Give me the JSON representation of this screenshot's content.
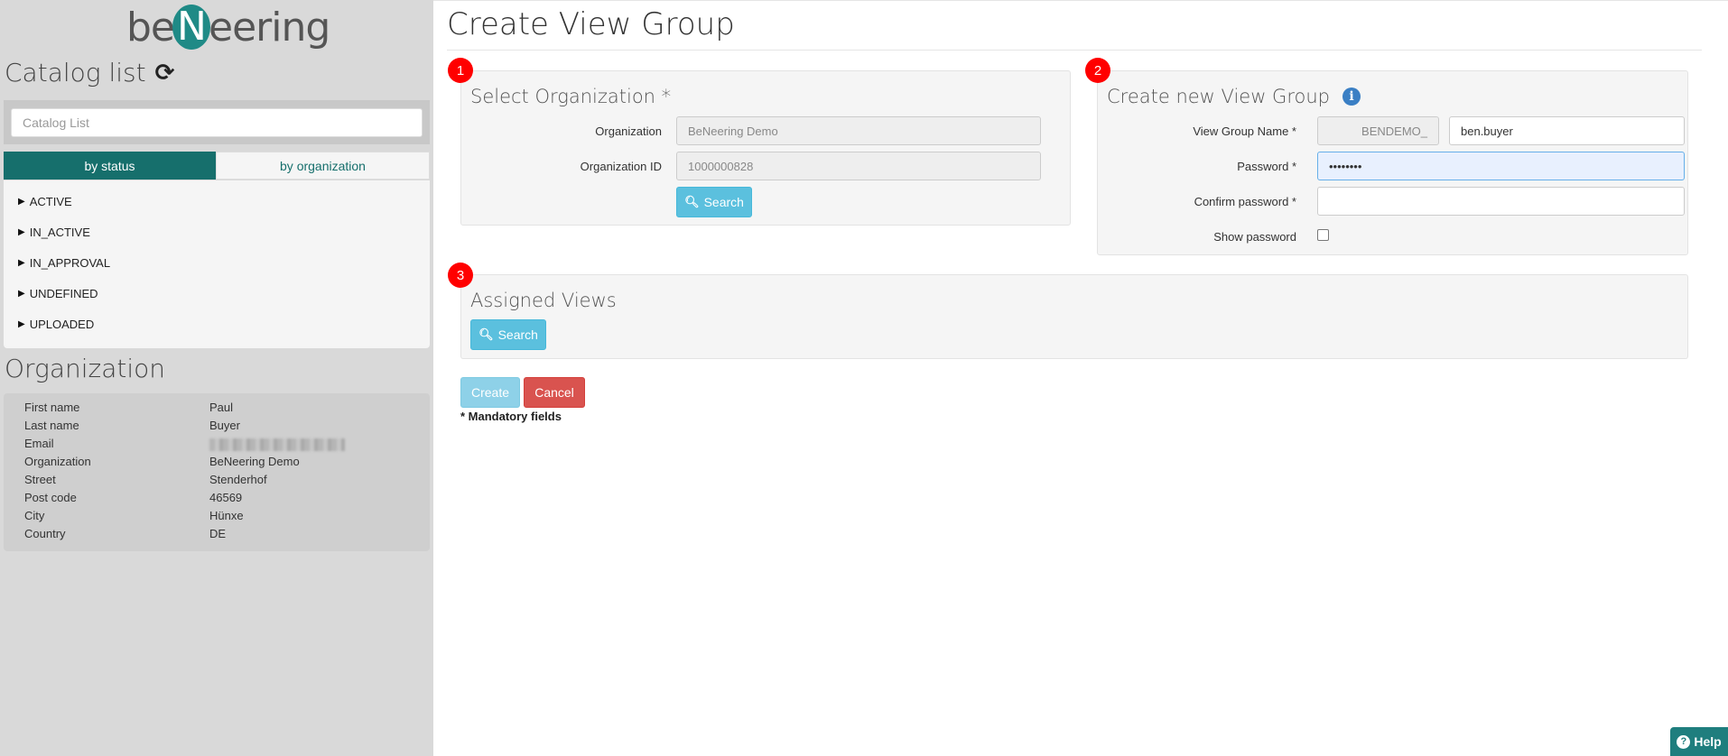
{
  "sidebar": {
    "logo": {
      "pre": "be",
      "mid": "N",
      "post": "eering"
    },
    "catalog_title": "Catalog list",
    "catalog_search_placeholder": "Catalog List",
    "tabs": {
      "by_status": "by status",
      "by_organization": "by organization"
    },
    "status_items": [
      "ACTIVE",
      "IN_ACTIVE",
      "IN_APPROVAL",
      "UNDEFINED",
      "UPLOADED"
    ],
    "organization_title": "Organization",
    "organization": {
      "first_name_label": "First name",
      "first_name": "Paul",
      "last_name_label": "Last name",
      "last_name": "Buyer",
      "email_label": "Email",
      "organization_label": "Organization",
      "organization": "BeNeering Demo",
      "street_label": "Street",
      "street": "Stenderhof",
      "post_code_label": "Post code",
      "post_code": "46569",
      "city_label": "City",
      "city": "Hünxe",
      "country_label": "Country",
      "country": "DE"
    }
  },
  "main": {
    "title": "Create View Group",
    "select_org": {
      "badge": "1",
      "heading": "Select Organization *",
      "organization_label": "Organization",
      "organization_value": "BeNeering Demo",
      "org_id_label": "Organization ID",
      "org_id_value": "1000000828",
      "search_label": "Search"
    },
    "new_group": {
      "badge": "2",
      "heading": "Create new View Group",
      "name_label": "View Group Name *",
      "name_prefix": "BENDEMO_",
      "name_value": "ben.buyer",
      "password_label": "Password *",
      "password_value": "••••••••",
      "confirm_label": "Confirm password *",
      "show_password_label": "Show password"
    },
    "assigned_views": {
      "badge": "3",
      "heading": "Assigned Views",
      "search_label": "Search"
    },
    "create_label": "Create",
    "cancel_label": "Cancel",
    "mandatory_note": "* Mandatory fields",
    "help_label": "Help"
  }
}
